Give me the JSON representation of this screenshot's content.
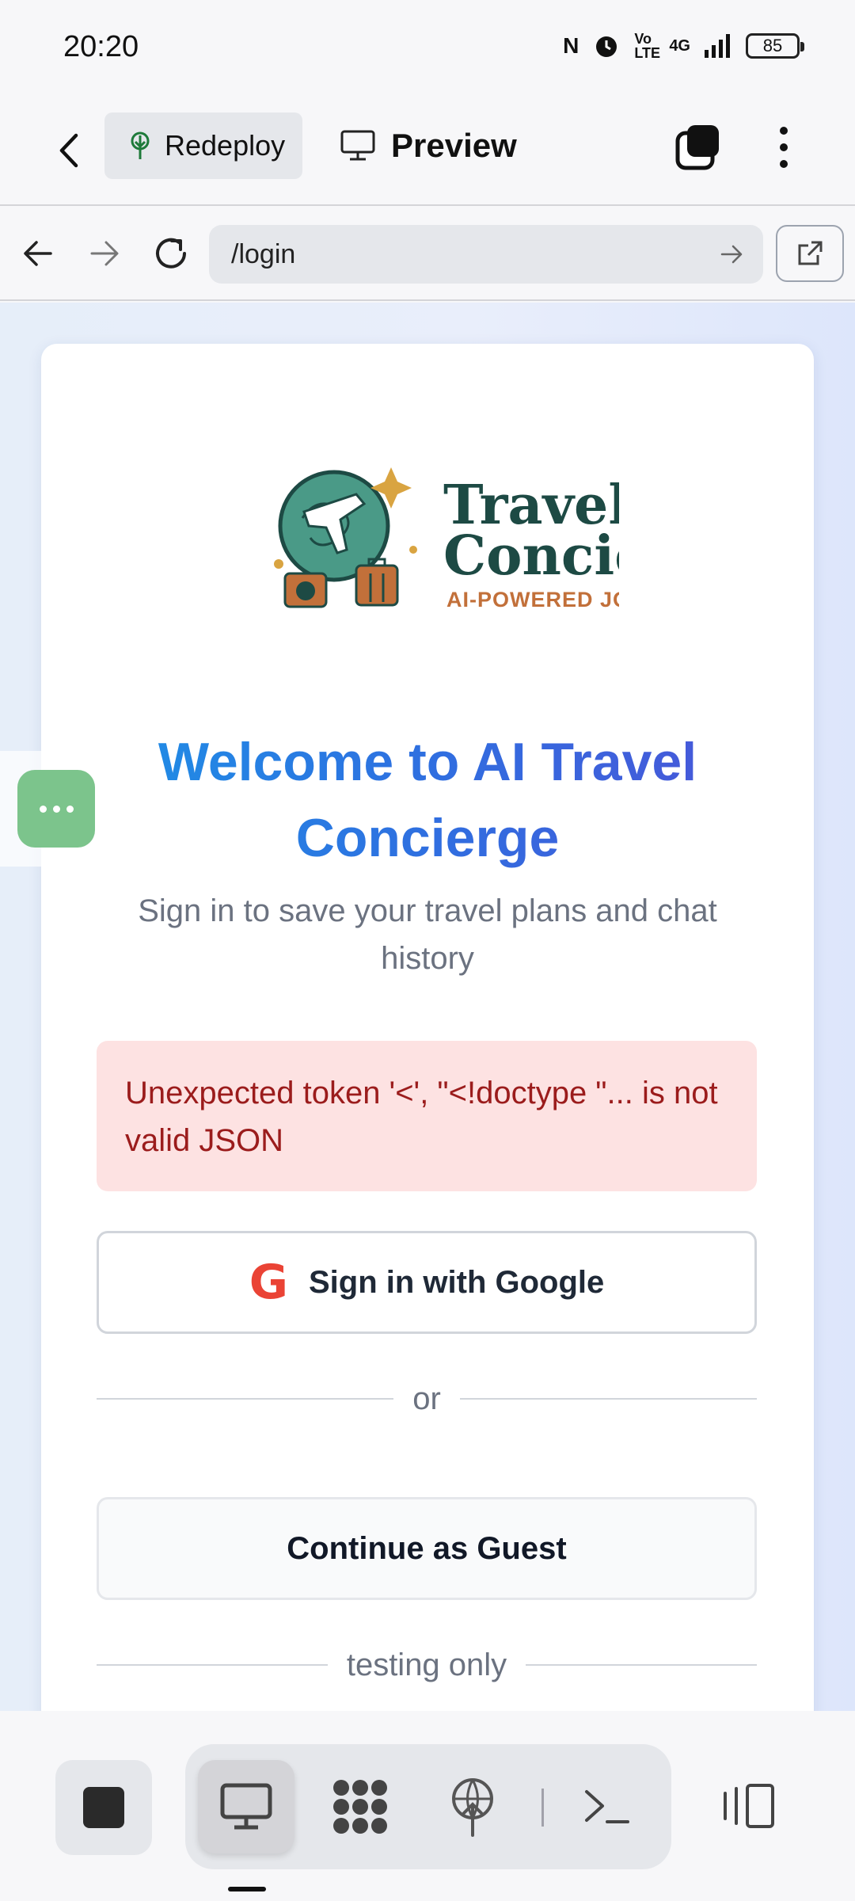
{
  "status_bar": {
    "time": "20:20",
    "nfc_label": "N",
    "volte_label": "Vo LTE",
    "network_label": "4G",
    "battery": "85"
  },
  "app_toolbar": {
    "redeploy_label": "Redeploy",
    "preview_label": "Preview"
  },
  "browser": {
    "url": "/login"
  },
  "logo": {
    "line1": "Travel",
    "line2": "Concie",
    "tagline": "AI-POWERED JO"
  },
  "login": {
    "title": "Welcome to AI Travel Concierge",
    "subtitle": "Sign in to save your travel plans and chat history",
    "error": "Unexpected token '<', \"<!doctype \"... is not valid JSON",
    "google_button": "Sign in with Google",
    "google_icon_letter": "G",
    "or_divider": "or",
    "guest_button": "Continue as Guest",
    "testing_divider": "testing only"
  },
  "colors": {
    "title_gradient_start": "#1e90e6",
    "title_gradient_end": "#4a55d8",
    "error_bg": "#fde2e2",
    "error_text": "#9b1c1c",
    "chat_bubble": "#7cc48c"
  },
  "icons": {
    "back": "back-chevron-icon",
    "redeploy": "redeploy-tree-icon",
    "preview": "monitor-icon",
    "tabs": "tabs-icon",
    "more": "more-vertical-icon",
    "nav_back": "arrow-left-icon",
    "nav_forward": "arrow-right-icon",
    "reload": "reload-icon",
    "open_external": "open-external-icon",
    "stop": "stop-icon",
    "preview_tool": "monitor-icon",
    "apps": "apps-icon",
    "deploy": "deploy-globe-icon",
    "terminal": "terminal-icon",
    "side_panel": "side-panel-icon"
  }
}
